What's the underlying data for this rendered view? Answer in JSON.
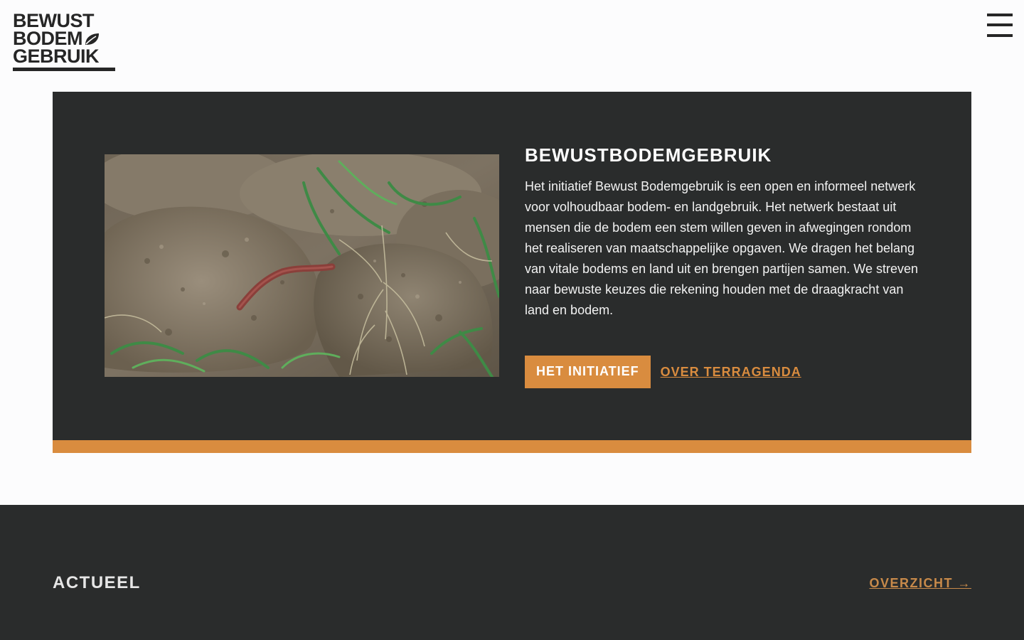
{
  "header": {
    "logo": {
      "line1": "BEWUST",
      "line2": "BODEM",
      "line3": "GEBRUIK"
    },
    "menu_icon": "hamburger-menu-icon"
  },
  "hero": {
    "image_icon": "earthworm-in-soil-photo",
    "title": "BEWUSTBODEMGEBRUIK",
    "body": "Het initiatief Bewust Bodemgebruik is een open en informeel netwerk voor volhoudbaar bodem- en landgebruik. Het netwerk bestaat uit mensen die de bodem een stem willen geven in afwegingen rondom het realiseren van maatschappelijke opgaven. We dragen het belang van vitale bodems en land uit en brengen partijen samen. We streven naar bewuste keuzes die rekening houden met de draagkracht van land en bodem.",
    "primary_button": "HET INITIATIEF",
    "secondary_link": "OVER TERRAGENDA"
  },
  "news": {
    "heading": "ACTUEEL",
    "overview_link": "OVERZICHT →"
  },
  "colors": {
    "accent": "#d98c3f",
    "dark_panel": "#2a2c2c",
    "page_background": "#fcfcfd",
    "logo": "#262626"
  }
}
